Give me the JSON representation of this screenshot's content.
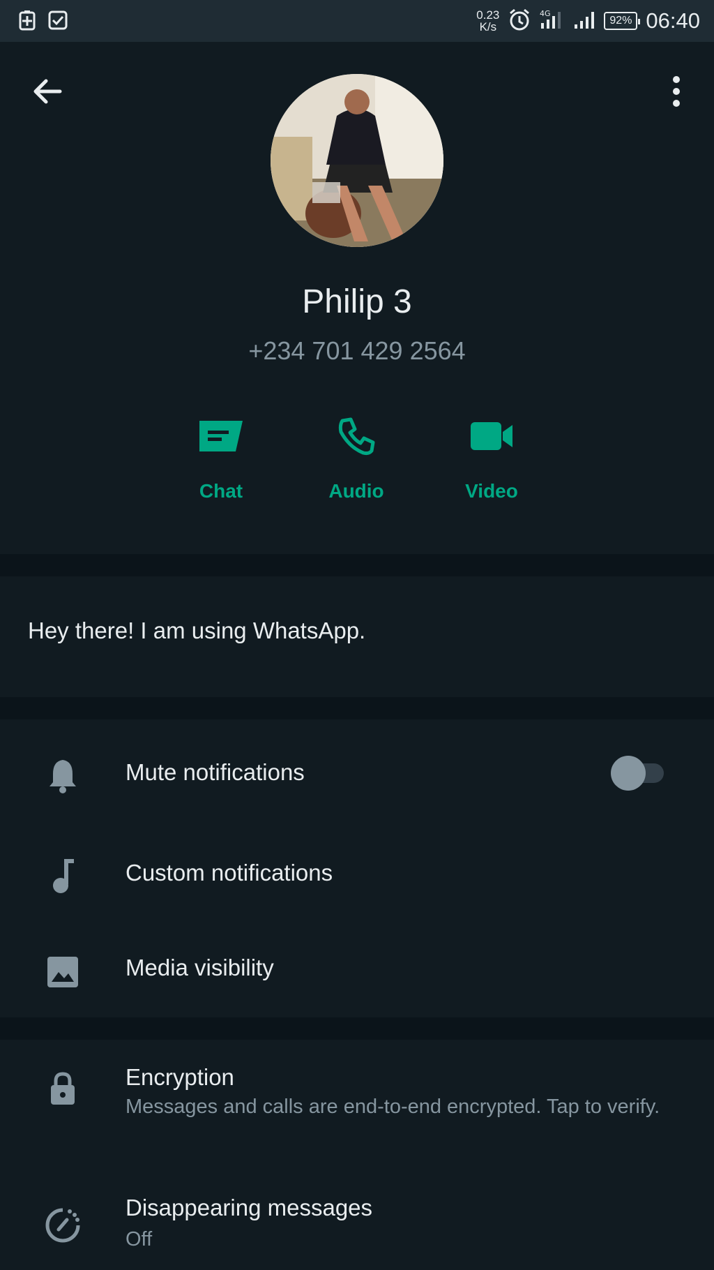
{
  "status_bar": {
    "net_speed_value": "0.23",
    "net_speed_unit": "K/s",
    "battery": "92%",
    "time": "06:40"
  },
  "profile": {
    "name": "Philip 3",
    "phone": "+234 701 429 2564"
  },
  "actions": [
    {
      "label": "Chat",
      "icon": "chat-icon"
    },
    {
      "label": "Audio",
      "icon": "phone-icon"
    },
    {
      "label": "Video",
      "icon": "video-icon"
    }
  ],
  "about": "Hey there! I am using WhatsApp.",
  "settings": {
    "mute": {
      "label": "Mute notifications",
      "enabled": false
    },
    "custom": {
      "label": "Custom notifications"
    },
    "media": {
      "label": "Media visibility"
    }
  },
  "encryption": {
    "title": "Encryption",
    "subtitle": "Messages and calls are end-to-end encrypted. Tap to verify."
  },
  "disappearing": {
    "title": "Disappearing messages",
    "value": "Off"
  },
  "colors": {
    "background": "#111b21",
    "divider": "#0b141a",
    "accent": "#00a884",
    "secondary_text": "#8696a0"
  }
}
